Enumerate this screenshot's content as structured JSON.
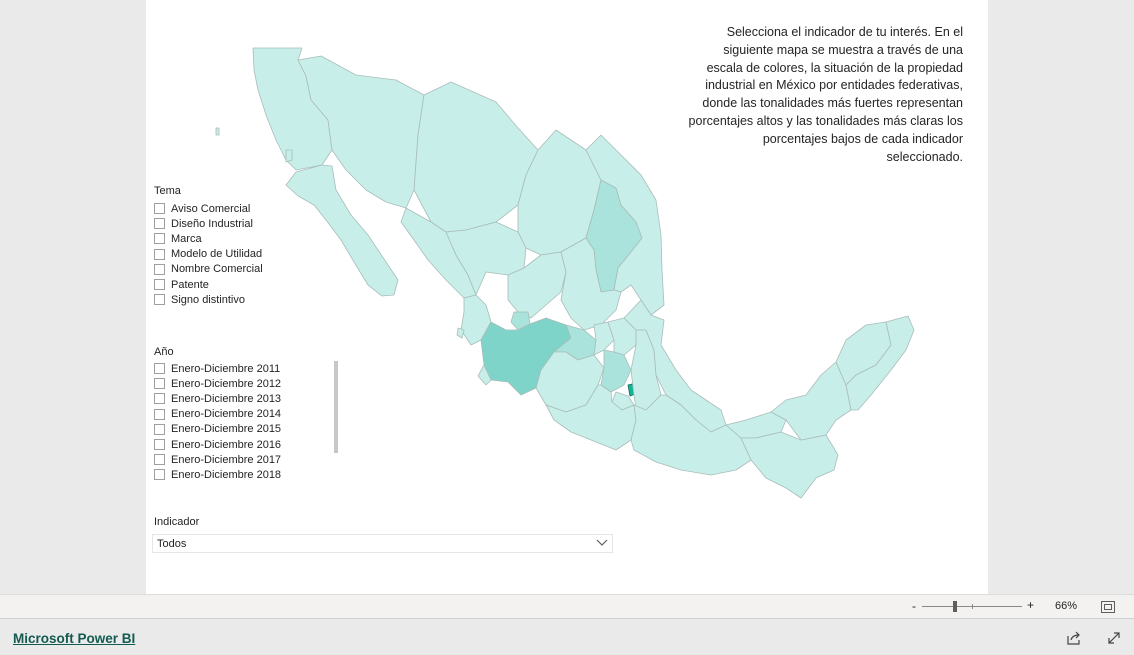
{
  "description": "Selecciona el indicador de tu interés. En el siguiente mapa se muestra a través de una escala de colores, la situación de la propiedad industrial en México por entidades federativas, donde las tonalidades más fuertes representan porcentajes altos y las tonalidades más claras los porcentajes bajos de cada indicador seleccionado.",
  "tema": {
    "title": "Tema",
    "options": [
      "Aviso Comercial",
      "Diseño Industrial",
      "Marca",
      "Modelo de Utilidad",
      "Nombre Comercial",
      "Patente",
      "Signo distintivo"
    ]
  },
  "anio": {
    "title": "Año",
    "options": [
      "Enero-Diciembre 2011",
      "Enero-Diciembre 2012",
      "Enero-Diciembre 2013",
      "Enero-Diciembre 2014",
      "Enero-Diciembre 2015",
      "Enero-Diciembre 2016",
      "Enero-Diciembre 2017",
      "Enero-Diciembre 2018"
    ]
  },
  "indicador": {
    "title": "Indicador",
    "selected": "Todos"
  },
  "zoom": {
    "minus": "-",
    "plus": "+",
    "level": "66%",
    "slider_fraction": 0.33
  },
  "footer": {
    "brand": "Microsoft Power BI"
  },
  "colors": {
    "map_light": "#c8eeea",
    "map_mid": "#a9e3dc",
    "map_strong": "#7fd4c9",
    "map_darkest": "#17b397",
    "brand": "#135b50"
  },
  "icons": [
    "chevron-down-icon",
    "fit-to-page-icon",
    "share-icon",
    "fullscreen-icon"
  ]
}
